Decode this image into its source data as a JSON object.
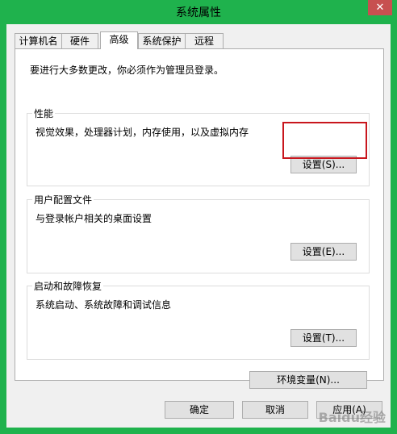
{
  "window": {
    "title": "系统属性",
    "close_glyph": "✕"
  },
  "tabs": [
    {
      "label": "计算机名",
      "active": false
    },
    {
      "label": "硬件",
      "active": false
    },
    {
      "label": "高级",
      "active": true
    },
    {
      "label": "系统保护",
      "active": false
    },
    {
      "label": "远程",
      "active": false
    }
  ],
  "admin_note": "要进行大多数更改，你必须作为管理员登录。",
  "performance": {
    "title": "性能",
    "description": "视觉效果，处理器计划，内存使用，以及虚拟内存",
    "button": "设置(S)..."
  },
  "user_profiles": {
    "title": "用户配置文件",
    "description": "与登录帐户相关的桌面设置",
    "button": "设置(E)..."
  },
  "startup_recovery": {
    "title": "启动和故障恢复",
    "description": "系统启动、系统故障和调试信息",
    "button": "设置(T)..."
  },
  "env_button": "环境变量(N)...",
  "footer": {
    "ok": "确定",
    "cancel": "取消",
    "apply": "应用(A)"
  },
  "watermark": "Baidu经验",
  "colors": {
    "frame": "#1fb24d",
    "close_button": "#c75050",
    "highlight": "#c8161d"
  }
}
